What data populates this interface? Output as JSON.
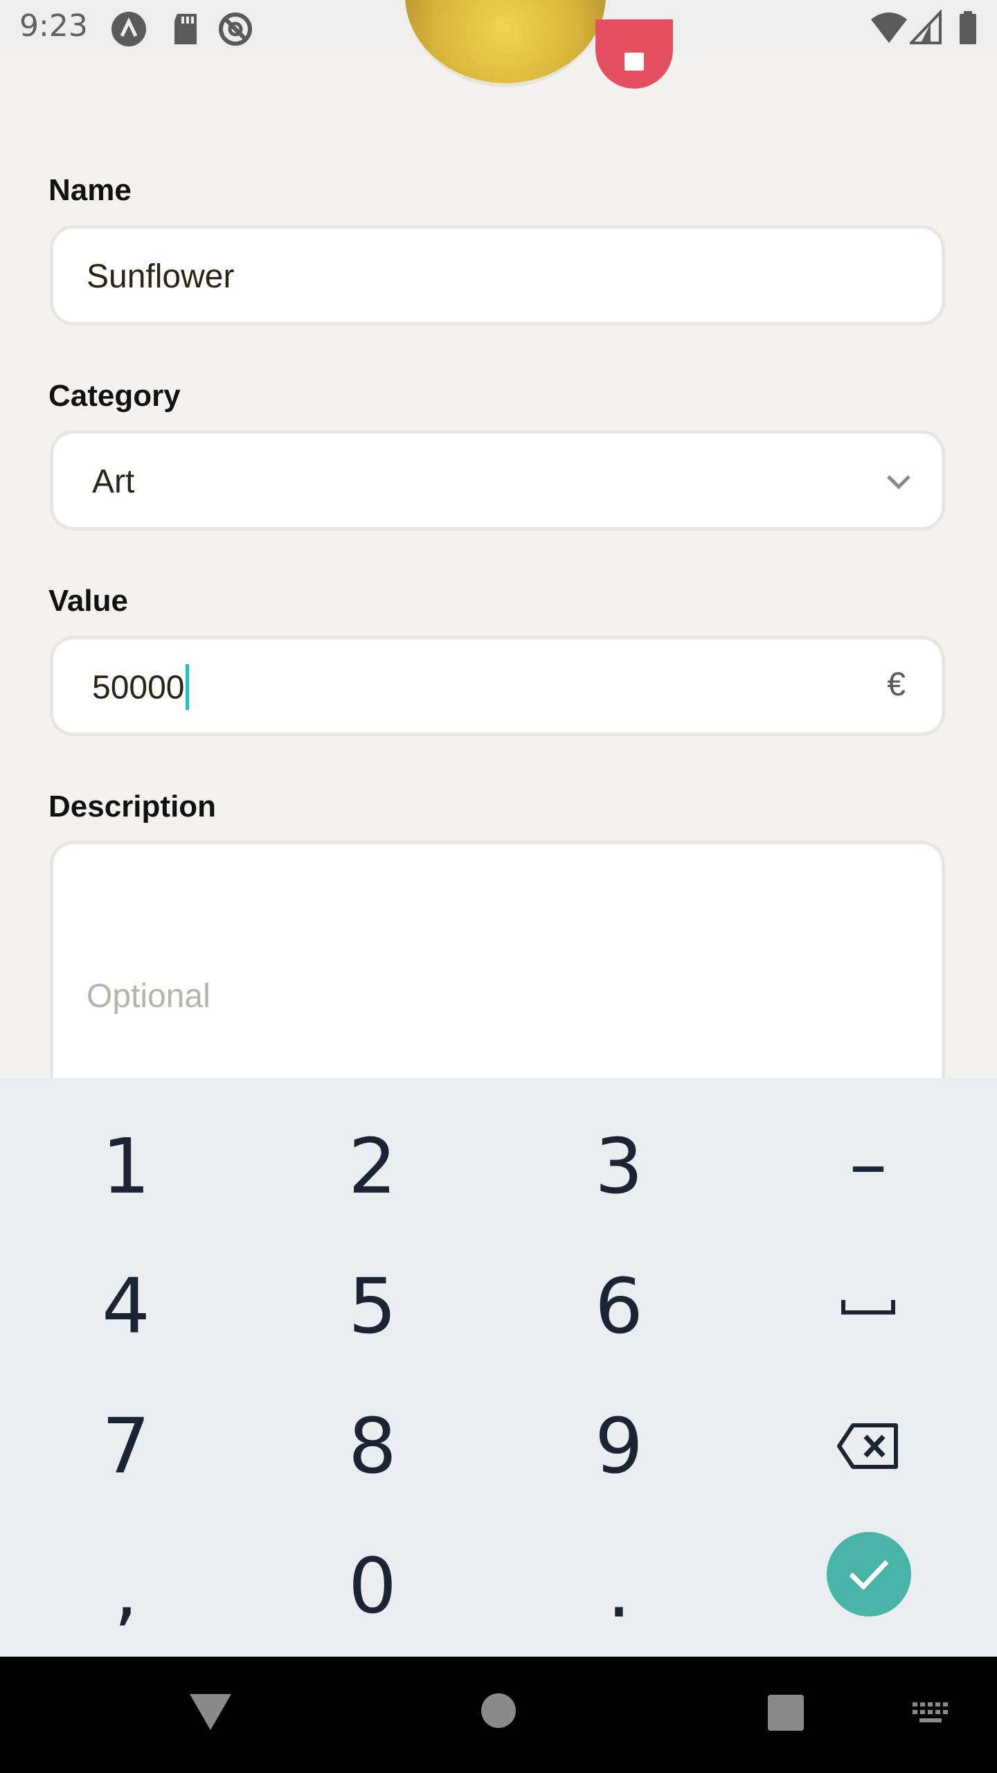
{
  "status_bar": {
    "time": "9:23"
  },
  "form": {
    "name_label": "Name",
    "name_value": "Sunflower",
    "category_label": "Category",
    "category_value": "Art",
    "value_label": "Value",
    "value_value": "50000",
    "currency_symbol": "€",
    "description_label": "Description",
    "description_placeholder": "Optional"
  },
  "keyboard": {
    "keys": [
      "1",
      "2",
      "3",
      "–",
      "4",
      "5",
      "6",
      "7",
      "8",
      "9",
      ",",
      "0",
      "."
    ]
  },
  "colors": {
    "accent": "#48b4a8",
    "delete": "#e4505f",
    "caret": "#1cc3c3"
  },
  "icons": [
    "signal-cell-icon",
    "sd-card-icon",
    "no-sync-icon",
    "wifi-icon",
    "cell-signal-icon",
    "battery-icon",
    "chevron-down-icon",
    "space-icon",
    "backspace-icon",
    "check-icon",
    "back-nav-icon",
    "home-nav-icon",
    "recents-nav-icon",
    "keyboard-switch-icon"
  ]
}
